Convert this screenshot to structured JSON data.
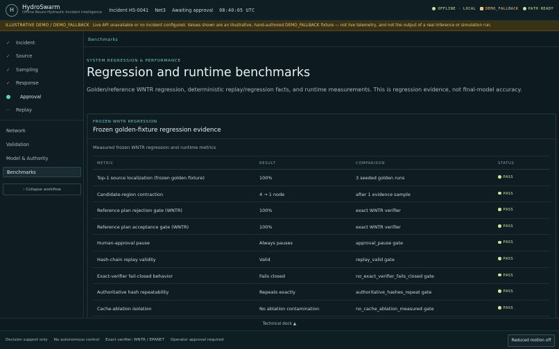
{
  "app": {
    "logo_letter": "H",
    "name": "HydroSwarm",
    "subtitle": "Offline Neuro-Hydraulic Incident Intelligence"
  },
  "incident": {
    "id": "Incident HS-0041",
    "network": "Net3",
    "state": "Awaiting approval",
    "time": "08:40:05 UTC"
  },
  "status": {
    "offline": "OFFLINE · LOCAL",
    "demo": "DEMO_FALLBACK",
    "path": "PATH READY",
    "colors": {
      "offline": "#cfe0a0",
      "demo": "#e8c58a",
      "path": "#cfe0a0"
    }
  },
  "banner": {
    "tag": "ILLUSTRATIVE DEMO / DEMO_FALLBACK",
    "message": "Live API unavailable or no incident configured. Values shown are an illustrative, hand-authored DEMO_FALLBACK fixture — not live telemetry, and not the output of a real inference or simulation run."
  },
  "workflow": [
    {
      "label": "Incident",
      "state": "done",
      "icon": "check-icon"
    },
    {
      "label": "Source",
      "state": "done",
      "icon": "check-icon"
    },
    {
      "label": "Sampling",
      "state": "done",
      "icon": "check-icon"
    },
    {
      "label": "Response",
      "state": "done",
      "icon": "check-icon"
    },
    {
      "label": "Approval",
      "state": "current",
      "icon": "current-dot-icon"
    },
    {
      "label": "Replay",
      "state": "pending",
      "icon": "pending-dots-icon"
    }
  ],
  "nav": {
    "network": "Network",
    "validation": "Validation",
    "model_authority": "Model & Authority",
    "benchmarks": "Benchmarks",
    "collapse": "‹ Collapse workflow"
  },
  "main": {
    "breadcrumb": "Benchmarks",
    "eyebrow": "SYSTEM REGRESSION & PERFORMANCE",
    "title": "Regression and runtime benchmarks",
    "lead": "Golden/reference WNTR regression, deterministic replay/regression facts, and runtime measurements. This is regression evidence, not final-model accuracy."
  },
  "card": {
    "eyebrow": "FROZEN WNTR REGRESSION",
    "title": "Frozen golden-fixture regression evidence",
    "description": "Measured frozen WNTR regression and runtime metrics",
    "columns": [
      "METRIC",
      "RESULT",
      "COMPARISON",
      "STATUS"
    ],
    "rows": [
      {
        "metric": "Top-1 source localization (frozen golden fixture)",
        "result": "100%",
        "comparison": "3 seeded golden runs",
        "status": "PASS"
      },
      {
        "metric": "Candidate-region contraction",
        "result": "4 → 1 node",
        "comparison": "after 1 evidence sample",
        "status": "PASS"
      },
      {
        "metric": "Reference plan rejection gate (WNTR)",
        "result": "100%",
        "comparison": "exact WNTR verifier",
        "status": "PASS"
      },
      {
        "metric": "Reference plan acceptance gate (WNTR)",
        "result": "100%",
        "comparison": "exact WNTR verifier",
        "status": "PASS"
      },
      {
        "metric": "Human-approval pause",
        "result": "Always pauses",
        "comparison": "approval_pause gate",
        "status": "PASS"
      },
      {
        "metric": "Hash-chain replay validity",
        "result": "Valid",
        "comparison": "replay_valid gate",
        "status": "PASS"
      },
      {
        "metric": "Exact-verifier fail-closed behavior",
        "result": "Fails closed",
        "comparison": "no_exact_verifier_fails_closed gate",
        "status": "PASS"
      },
      {
        "metric": "Authoritative hash repeatability",
        "result": "Repeats exactly",
        "comparison": "authoritative_hashes_repeat gate",
        "status": "PASS"
      },
      {
        "metric": "Cache-ablation isolation",
        "result": "No ablation contamination",
        "comparison": "no_cache_ablation_measured gate",
        "status": "PASS"
      }
    ]
  },
  "dock": {
    "label": "Technical dock ▲"
  },
  "footer": {
    "items": [
      "Decision support only",
      "No autonomous control",
      "Exact verifier: WNTR / EPANET",
      "Operator approval required"
    ],
    "reduced_motion": "Reduced motion off"
  }
}
